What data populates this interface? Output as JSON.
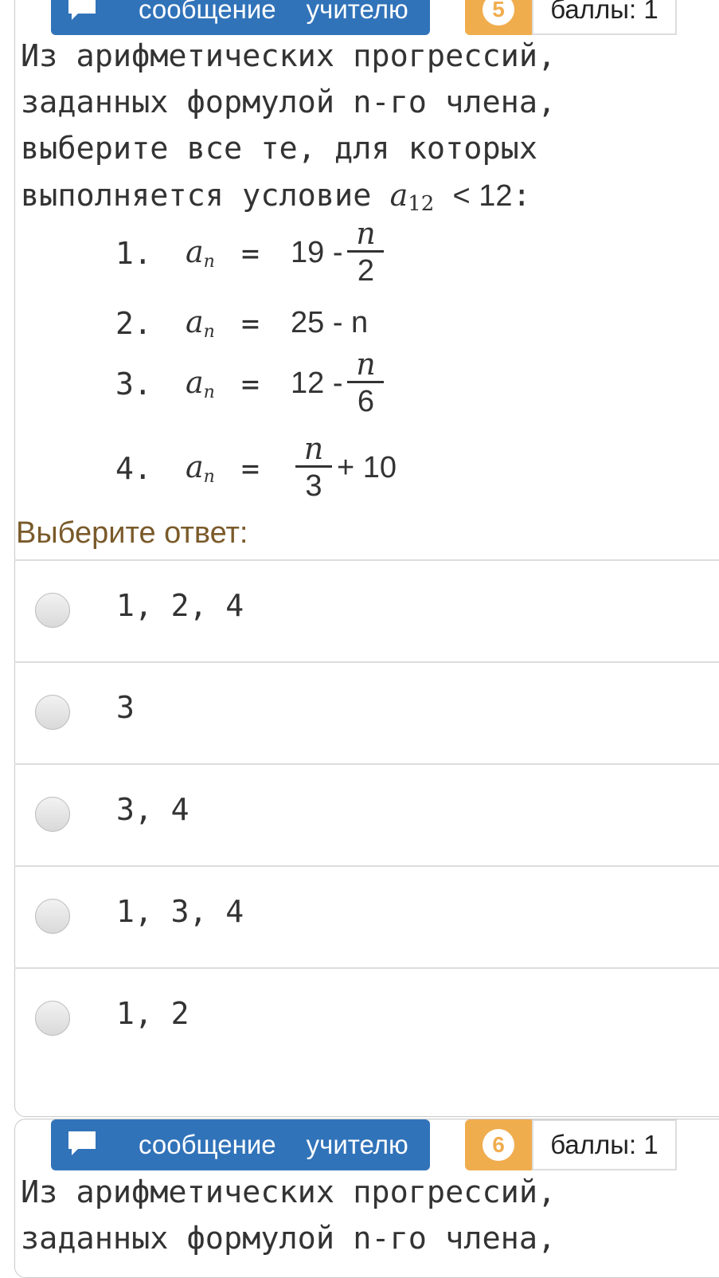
{
  "question1": {
    "message_button": {
      "word1": "сообщение",
      "word2": "учителю"
    },
    "number": "5",
    "score": "баллы: 1",
    "text_lines": [
      "Из арифметических прогрессий,",
      "заданных формулой n-го члена,",
      "выберите все те, для которых",
      "выполняется условие"
    ],
    "condition": {
      "symbol": "a",
      "index": "12",
      "relation": "< 12",
      "colon": ":"
    },
    "formulas": [
      {
        "num": "1.",
        "lhs": "a",
        "sub": "n",
        "eq": "=",
        "pre": "19 -",
        "frac_top": "n",
        "frac_bot": "2",
        "post": ""
      },
      {
        "num": "2.",
        "lhs": "a",
        "sub": "n",
        "eq": "=",
        "pre": "25 - n",
        "frac_top": "",
        "frac_bot": "",
        "post": ""
      },
      {
        "num": "3.",
        "lhs": "a",
        "sub": "n",
        "eq": "=",
        "pre": "12 -",
        "frac_top": "n",
        "frac_bot": "6",
        "post": ""
      },
      {
        "num": "4.",
        "lhs": "a",
        "sub": "n",
        "eq": "=",
        "pre": "",
        "frac_top": "n",
        "frac_bot": "3",
        "post": "+ 10"
      }
    ],
    "prompt": "Выберите ответ:",
    "options": [
      "1, 2, 4",
      "3",
      "3, 4",
      "1, 3, 4",
      "1, 2"
    ]
  },
  "question2": {
    "message_button": {
      "word1": "сообщение",
      "word2": "учителю"
    },
    "number": "6",
    "score": "баллы: 1",
    "text_lines": [
      "Из арифметических прогрессий,",
      "заданных формулой n-го члена,"
    ]
  },
  "colors": {
    "button_blue": "#3173b9",
    "badge_orange": "#f0ad4e",
    "prompt_brown": "#7a5a2a"
  }
}
